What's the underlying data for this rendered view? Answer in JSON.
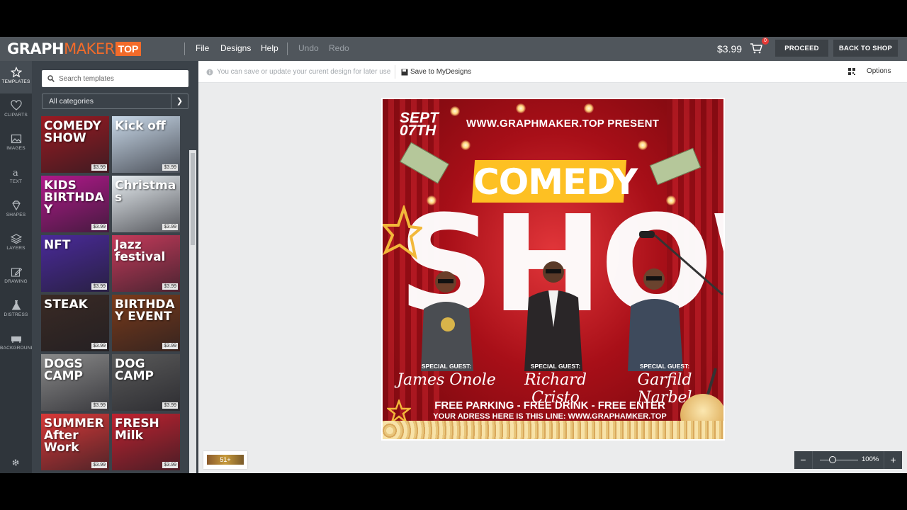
{
  "header": {
    "logo_graph": "GRAPH",
    "logo_maker": "MAKER",
    "logo_top": "TOP",
    "menu": [
      "File",
      "Designs",
      "Help"
    ],
    "undo": "Undo",
    "redo": "Redo",
    "price": "$3.99",
    "cart_count": "0",
    "proceed": "PROCEED",
    "back_to_shop": "BACK TO SHOP"
  },
  "rail": {
    "items": [
      "TEMPLATES",
      "CLIPARTS",
      "IMAGES",
      "TEXT",
      "SHAPES",
      "LAYERS",
      "DRAWING",
      "DISTRESS",
      "BACKGROUND"
    ]
  },
  "panel": {
    "search_placeholder": "Search templates",
    "category": "All categories",
    "thumbs": [
      {
        "title": "COMEDY SHOW",
        "price": "$3.99",
        "bg": "#9b1a22"
      },
      {
        "title": "Kick off",
        "price": "$3.99",
        "bg": "#c8d8e8"
      },
      {
        "title": "KIDS BIRTHDAY",
        "price": "$3.99",
        "bg": "#b0188a"
      },
      {
        "title": "Christmas",
        "price": "$3.99",
        "bg": "#e8eef2"
      },
      {
        "title": "NFT",
        "price": "$3.99",
        "bg": "#4a2a9a"
      },
      {
        "title": "Jazz festival",
        "price": "$3.99",
        "bg": "#c43a5a"
      },
      {
        "title": "STEAK",
        "price": "$3.99",
        "bg": "#3a2a24"
      },
      {
        "title": "BIRTHDAY EVENT",
        "price": "$3.99",
        "bg": "#7a3a1a"
      },
      {
        "title": "DOGS CAMP",
        "price": "$3.99",
        "bg": "#8a8a8a"
      },
      {
        "title": "DOG CAMP",
        "price": "$3.99",
        "bg": "#5a5a5a"
      },
      {
        "title": "SUMMER After Work",
        "price": "$3.99",
        "bg": "#d83838"
      },
      {
        "title": "FRESH Milk",
        "price": "$3.99",
        "bg": "#c02230"
      }
    ]
  },
  "options_bar": {
    "hint": "You can save or update your curent design for later use",
    "save": "Save to MyDesigns",
    "options": "Options"
  },
  "flyer": {
    "date_line1": "SEPT",
    "date_line2": "07TH",
    "present": "WWW.GRAPHMAKER.TOP PRESENT",
    "comedy": "COMEDY",
    "show": "SHOW",
    "guests": [
      {
        "label": "SPECIAL GUEST:",
        "name": "James Onole"
      },
      {
        "label": "SPECIAL GUEST:",
        "name": "Richard Cristo"
      },
      {
        "label": "SPECIAL GUEST:",
        "name": "Garfild Narbel"
      }
    ],
    "free_line": "FREE PARKING - FREE DRINK - FREE ENTER",
    "address_line": "YOUR ADRESS HERE IS THIS LINE: WWW.GRAPHAMKER.TOP"
  },
  "footer": {
    "badge": "51+",
    "zoom_minus": "−",
    "zoom_plus": "+",
    "zoom_pct": "100%",
    "zoom_level": 0.33
  },
  "colors": {
    "accent": "#f26b2a",
    "topbar": "#50565c",
    "panel": "#3b4249",
    "comedy_box": "#fdc023"
  }
}
